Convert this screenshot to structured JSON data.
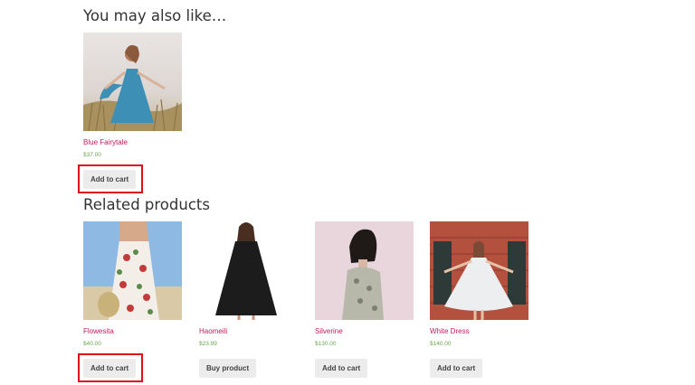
{
  "sections": {
    "upsell_title": "You may also like…",
    "related_title": "Related products"
  },
  "upsell": [
    {
      "name": "Blue Fairytale",
      "price": "$37.00",
      "button": "Add to cart",
      "image": "woman-in-blue-dress-in-field"
    }
  ],
  "related": [
    {
      "name": "Flowesita",
      "price": "$40.00",
      "button": "Add to cart",
      "image": "woman-in-floral-wrap-dress"
    },
    {
      "name": "Haomeili",
      "price": "$23.99",
      "button": "Buy product",
      "image": "black-swing-dress"
    },
    {
      "name": "Silverine",
      "price": "$130.00",
      "button": "Add to cart",
      "image": "woman-in-silver-top-side-view"
    },
    {
      "name": "White Dress",
      "price": "$140.00",
      "button": "Add to cart",
      "image": "woman-in-white-dress-from-behind"
    }
  ],
  "colors": {
    "link": "#c8185c",
    "price": "#6aa84f",
    "button_bg": "#ececec",
    "highlight": "#e0101a"
  }
}
